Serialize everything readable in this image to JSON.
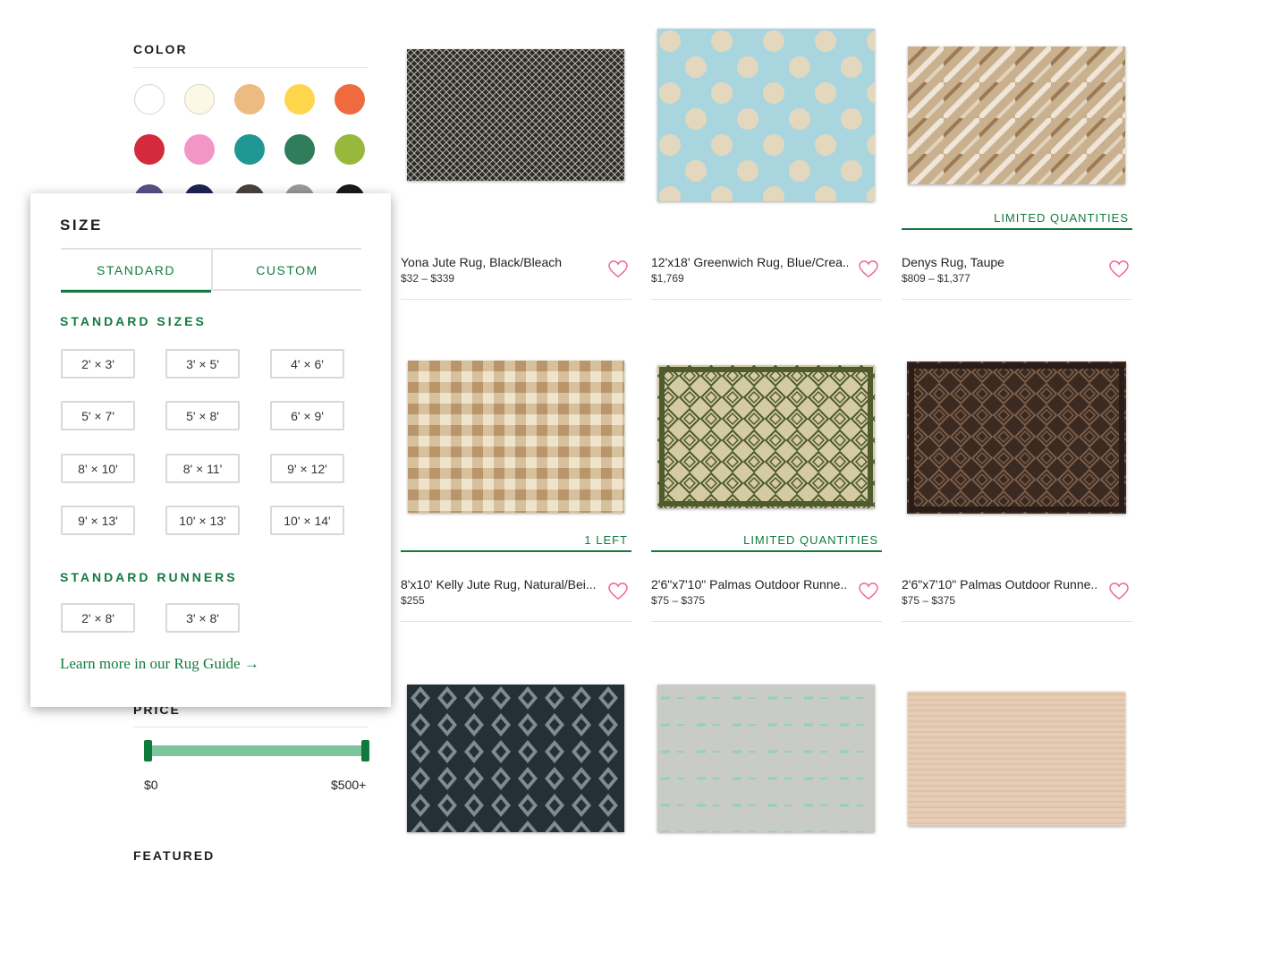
{
  "filters": {
    "color": {
      "title": "COLOR",
      "swatches": [
        {
          "name": "white",
          "hex": "#ffffff"
        },
        {
          "name": "cream",
          "hex": "#fbf9e6"
        },
        {
          "name": "tan",
          "hex": "#ecbb7f"
        },
        {
          "name": "yellow",
          "hex": "#fdd64b"
        },
        {
          "name": "orange",
          "hex": "#ef6a3f"
        },
        {
          "name": "red",
          "hex": "#d42b3c"
        },
        {
          "name": "pink",
          "hex": "#f396c5"
        },
        {
          "name": "teal",
          "hex": "#1f9894"
        },
        {
          "name": "green",
          "hex": "#2f7d5a"
        },
        {
          "name": "lime",
          "hex": "#97b83c"
        },
        {
          "name": "purple",
          "hex": "#5d4f8a"
        },
        {
          "name": "navy",
          "hex": "#1e2454"
        },
        {
          "name": "brown",
          "hex": "#4c413a"
        },
        {
          "name": "gray",
          "hex": "#9a9a9a"
        },
        {
          "name": "black",
          "hex": "#1a1a1a"
        }
      ]
    },
    "size": {
      "title": "SIZE",
      "tabs": [
        "STANDARD",
        "CUSTOM"
      ],
      "standard_sizes_title": "STANDARD SIZES",
      "standard_sizes": [
        "2' × 3'",
        "3' × 5'",
        "4' × 6'",
        "5' × 7'",
        "5' × 8'",
        "6' × 9'",
        "8' × 10'",
        "8' × 11'",
        "9' × 12'",
        "9' × 13'",
        "10' × 13'",
        "10' × 14'"
      ],
      "runners_title": "STANDARD RUNNERS",
      "runners": [
        "2' × 8'",
        "3' × 8'"
      ],
      "guide_link": "Learn more in our Rug Guide →"
    },
    "price": {
      "title": "PRICE",
      "min_label": "$0",
      "max_label": "$500+"
    },
    "featured": {
      "title": "FEATURED"
    }
  },
  "products": [
    {
      "name": "Yona Jute Rug, Black/Bleach",
      "price": "$32 – $339",
      "badge": ""
    },
    {
      "name": "12'x18' Greenwich Rug, Blue/Crea...",
      "price": "$1,769",
      "badge": ""
    },
    {
      "name": "Denys Rug, Taupe",
      "price": "$809 – $1,377",
      "badge": "LIMITED QUANTITIES"
    },
    {
      "name": "8'x10' Kelly Jute Rug, Natural/Bei...",
      "price": "$255",
      "badge": "1 LEFT"
    },
    {
      "name": "2'6\"x7'10\" Palmas Outdoor Runne...",
      "price": "$75 – $375",
      "badge": "LIMITED QUANTITIES"
    },
    {
      "name": "2'6\"x7'10\" Palmas Outdoor Runne...",
      "price": "$75 – $375",
      "badge": ""
    },
    {
      "name": "",
      "price": "",
      "badge": ""
    },
    {
      "name": "",
      "price": "",
      "badge": ""
    },
    {
      "name": "",
      "price": "",
      "badge": ""
    }
  ]
}
